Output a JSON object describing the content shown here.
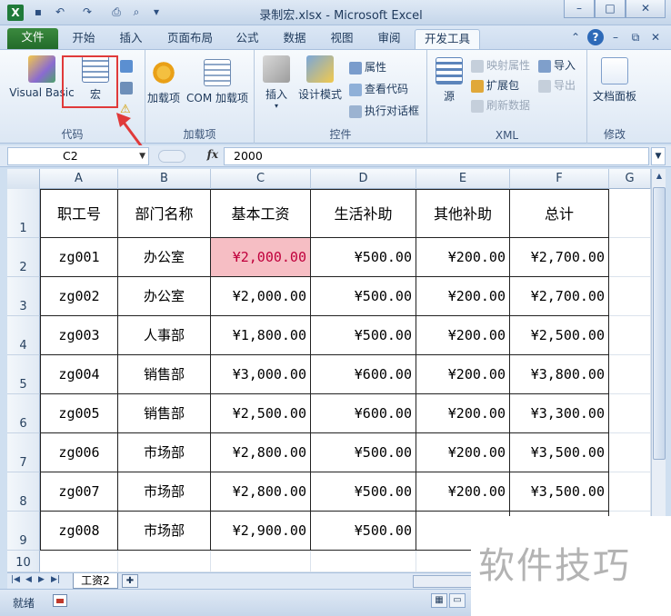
{
  "window": {
    "title": "录制宏.xlsx - Microsoft Excel",
    "app_icon": "excel-icon",
    "quick_access": [
      "save-icon",
      "undo-icon",
      "redo-icon",
      "print-icon",
      "print-preview-icon",
      "customize-icon"
    ]
  },
  "ribbon_tabs": [
    {
      "label": "文件"
    },
    {
      "label": "开始"
    },
    {
      "label": "插入"
    },
    {
      "label": "页面布局"
    },
    {
      "label": "公式"
    },
    {
      "label": "数据"
    },
    {
      "label": "视图"
    },
    {
      "label": "审阅"
    },
    {
      "label": "开发工具",
      "active": true
    }
  ],
  "ribbon": {
    "code": {
      "label": "代码",
      "visual_basic": "Visual Basic",
      "macros": "宏"
    },
    "addins": {
      "label": "加载项",
      "addins": "加载项",
      "com_addins": "COM 加载项"
    },
    "controls": {
      "label": "控件",
      "insert": "插入",
      "design_mode": "设计模式",
      "properties": "属性",
      "view_code": "查看代码",
      "run_dialog": "执行对话框"
    },
    "xml": {
      "label": "XML",
      "source": "源",
      "map_properties": "映射属性",
      "expansion_packs": "扩展包",
      "refresh_data": "刷新数据",
      "import": "导入",
      "export": "导出"
    },
    "modify": {
      "label": "修改",
      "document_panel": "文档面板"
    }
  },
  "formula_bar": {
    "name_box": "C2",
    "fx": "fx",
    "content": "2000"
  },
  "columns": [
    "A",
    "B",
    "C",
    "D",
    "E",
    "F",
    "G"
  ],
  "rows": [
    "1",
    "2",
    "3",
    "4",
    "5",
    "6",
    "7",
    "8",
    "9",
    "10"
  ],
  "table": {
    "headers": [
      "职工号",
      "部门名称",
      "基本工资",
      "生活补助",
      "其他补助",
      "总计"
    ],
    "rows": [
      [
        "zg001",
        "办公室",
        "¥2,000.00",
        "¥500.00",
        "¥200.00",
        "¥2,700.00"
      ],
      [
        "zg002",
        "办公室",
        "¥2,000.00",
        "¥500.00",
        "¥200.00",
        "¥2,700.00"
      ],
      [
        "zg003",
        "人事部",
        "¥1,800.00",
        "¥500.00",
        "¥200.00",
        "¥2,500.00"
      ],
      [
        "zg004",
        "销售部",
        "¥3,000.00",
        "¥600.00",
        "¥200.00",
        "¥3,800.00"
      ],
      [
        "zg005",
        "销售部",
        "¥2,500.00",
        "¥600.00",
        "¥200.00",
        "¥3,300.00"
      ],
      [
        "zg006",
        "市场部",
        "¥2,800.00",
        "¥500.00",
        "¥200.00",
        "¥3,500.00"
      ],
      [
        "zg007",
        "市场部",
        "¥2,800.00",
        "¥500.00",
        "¥200.00",
        "¥3,500.00"
      ],
      [
        "zg008",
        "市场部",
        "¥2,900.00",
        "¥500.00",
        "¥20",
        ""
      ]
    ],
    "selected_cell": "C2"
  },
  "sheet_tabs": [
    {
      "label": "工资2"
    }
  ],
  "status": {
    "ready": "就绪"
  },
  "watermark": "软件技巧",
  "colors": {
    "highlight_fill": "#f6bec4",
    "highlight_text": "#c0003c",
    "annotation_red": "#e03a3a",
    "file_tab_green": "#2e7d32"
  }
}
